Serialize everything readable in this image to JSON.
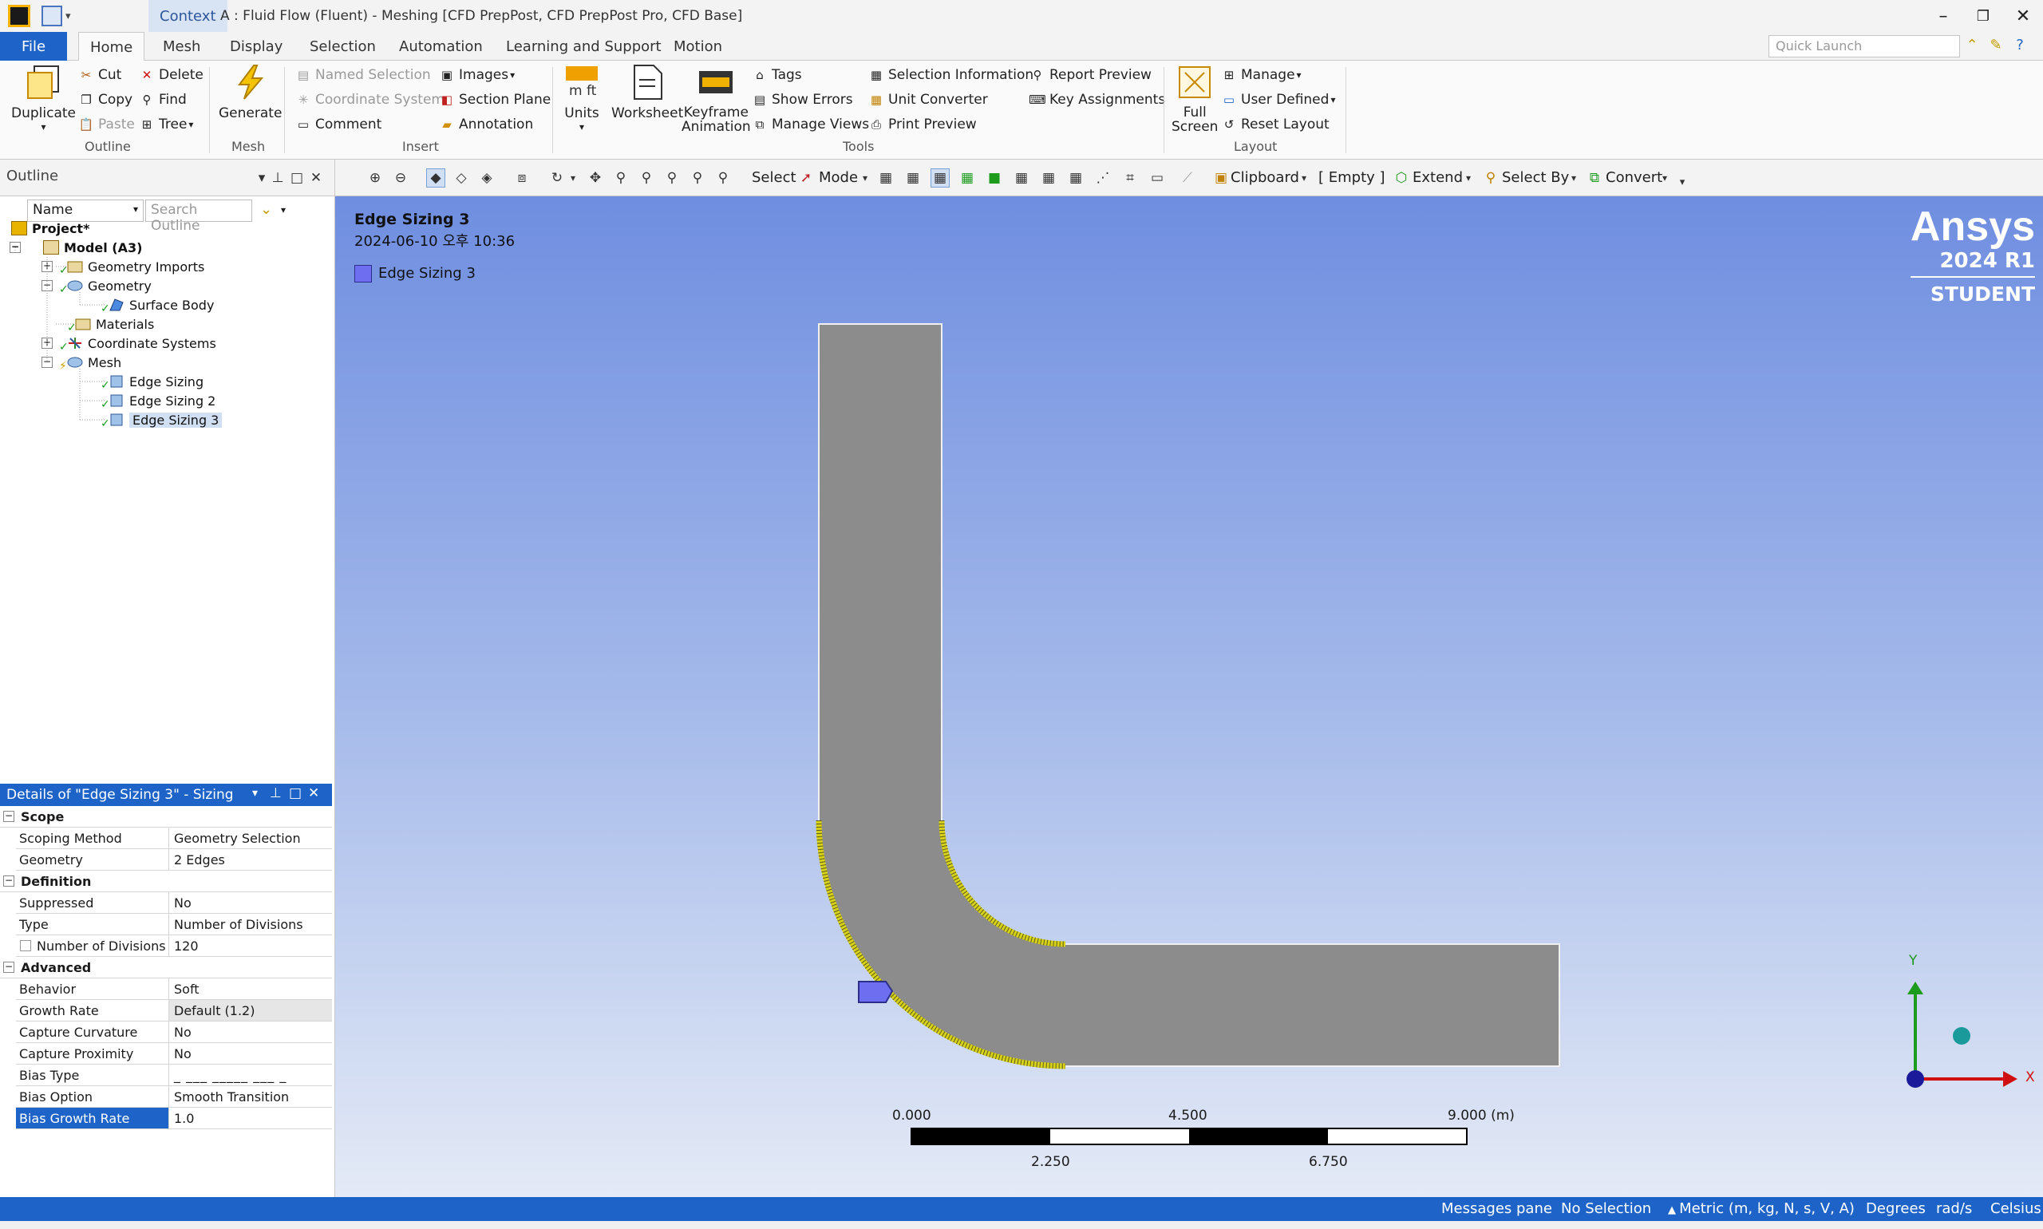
{
  "titlebar": {
    "context_tab": "Context",
    "title": "A : Fluid Flow (Fluent) - Meshing [CFD PrepPost, CFD PrepPost Pro, CFD Base]"
  },
  "ribbon_tabs": {
    "file": "File",
    "tabs": [
      "Home",
      "Mesh",
      "Display",
      "Selection",
      "Automation",
      "Learning and Support",
      "Motion"
    ],
    "quick_launch_placeholder": "Quick Launch"
  },
  "ribbon": {
    "outline_group": {
      "label": "Outline",
      "duplicate": "Duplicate",
      "cut": "Cut",
      "copy": "Copy",
      "paste": "Paste",
      "delete": "Delete",
      "find": "Find",
      "tree": "Tree"
    },
    "mesh_group": {
      "label": "Mesh",
      "generate": "Generate"
    },
    "insert_group": {
      "label": "Insert",
      "named_selection": "Named Selection",
      "coordinate_system": "Coordinate System",
      "comment": "Comment",
      "images": "Images",
      "section_plane": "Section Plane",
      "annotation": "Annotation"
    },
    "tools_group": {
      "label": "Tools",
      "units": "Units",
      "worksheet": "Worksheet",
      "keyframe_1": "Keyframe",
      "keyframe_2": "Animation",
      "tags": "Tags",
      "show_errors": "Show Errors",
      "manage_views": "Manage Views",
      "selection_information": "Selection Information",
      "unit_converter": "Unit Converter",
      "print_preview": "Print Preview",
      "report_preview": "Report Preview",
      "key_assignments": "Key Assignments"
    },
    "layout_group": {
      "label": "Layout",
      "full_1": "Full",
      "full_2": "Screen",
      "manage": "Manage",
      "user_defined": "User Defined",
      "reset_layout": "Reset Layout"
    }
  },
  "toolbar": {
    "outline_title": "Outline",
    "select": "Select",
    "mode": "Mode",
    "clipboard": "Clipboard",
    "empty": "[ Empty ]",
    "extend": "Extend",
    "select_by": "Select By",
    "convert": "Convert"
  },
  "outline": {
    "filter_value": "Name",
    "search_placeholder": "Search Outline",
    "items": [
      "Project*",
      "Model (A3)",
      "Geometry Imports",
      "Geometry",
      "Surface Body",
      "Materials",
      "Coordinate Systems",
      "Mesh",
      "Edge Sizing",
      "Edge Sizing 2",
      "Edge Sizing 3"
    ]
  },
  "details": {
    "header": "Details of \"Edge Sizing 3\" - Sizing",
    "sections": {
      "scope": "Scope",
      "definition": "Definition",
      "advanced": "Advanced"
    },
    "rows": [
      {
        "key": "Scoping Method",
        "value": "Geometry Selection"
      },
      {
        "key": "Geometry",
        "value": "2 Edges"
      },
      {
        "key": "Suppressed",
        "value": "No"
      },
      {
        "key": "Type",
        "value": "Number of Divisions"
      },
      {
        "key": "Number of Divisions",
        "value": "120"
      },
      {
        "key": "Behavior",
        "value": "Soft"
      },
      {
        "key": "Growth Rate",
        "value": "Default (1.2)"
      },
      {
        "key": "Capture Curvature",
        "value": "No"
      },
      {
        "key": "Capture Proximity",
        "value": "No"
      },
      {
        "key": "Bias Type",
        "value": "_ ___ _____ ___ _"
      },
      {
        "key": "Bias Option",
        "value": "Smooth Transition"
      },
      {
        "key": "Bias Growth Rate",
        "value": "1.0"
      }
    ]
  },
  "viewport": {
    "title": "Edge Sizing 3",
    "date": "2024-06-10 오후 10:36",
    "legend": "Edge Sizing 3",
    "brand_name": "Ansys",
    "brand_version": "2024 R1",
    "brand_edition": "STUDENT",
    "scale_labels": [
      "0.000",
      "4.500",
      "9.000 (m)",
      "2.250",
      "6.750"
    ],
    "axis_x": "X",
    "axis_y": "Y",
    "colors": {
      "body": "#8c8c8c",
      "highlight": "#d7d11a",
      "marker": "#6d6ff0"
    }
  },
  "statusbar": {
    "messages": "Messages pane",
    "selection": "No Selection",
    "units": "Metric (m, kg, N, s, V, A)",
    "angle": "Degrees",
    "rate": "rad/s",
    "temperature": "Celsius"
  }
}
